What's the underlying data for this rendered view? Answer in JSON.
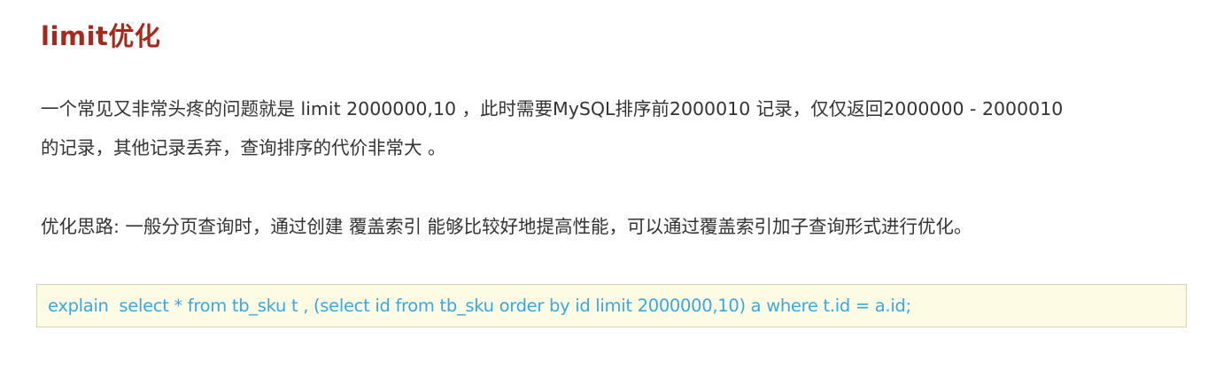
{
  "heading": "limit优化",
  "paragraphs": {
    "line1": "一个常见又非常头疼的问题就是 limit 2000000,10 ，此时需要MySQL排序前2000010 记录，仅仅返回2000000 - 2000010",
    "line2": "的记录，其他记录丢弃，查询排序的代价非常大 。",
    "line3": "优化思路: 一般分页查询时，通过创建 覆盖索引 能够比较好地提高性能，可以通过覆盖索引加子查询形式进行优化。"
  },
  "code": {
    "sql": "explain  select * from tb_sku t , (select id from tb_sku order by id limit 2000000,10) a where t.id = a.id;"
  },
  "colors": {
    "heading": "#a52a1e",
    "body_text": "#333333",
    "code_text": "#3aa8e0",
    "code_background": "#fdfbe3",
    "code_border": "#d7d3b8"
  }
}
